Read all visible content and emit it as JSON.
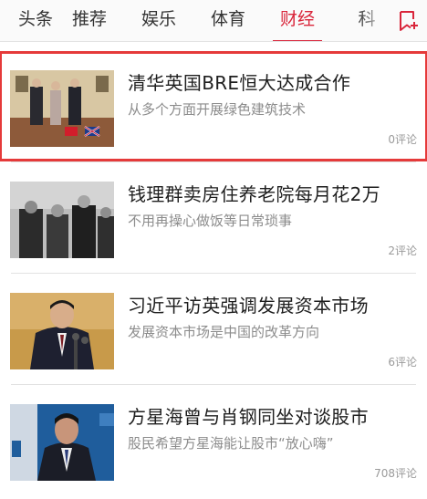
{
  "tabbar": {
    "tabs": [
      {
        "label": "头条",
        "active": false
      },
      {
        "label": "推荐",
        "active": false
      },
      {
        "label": "娱乐",
        "active": false
      },
      {
        "label": "体育",
        "active": false
      },
      {
        "label": "财经",
        "active": true
      },
      {
        "label": "科",
        "active": false
      }
    ],
    "add_icon": "add-channel-icon",
    "accent_color": "#d9263b"
  },
  "feed": {
    "items": [
      {
        "title": "清华英国BRE恒大达成合作",
        "subtitle": "从多个方面开展绿色建筑技术",
        "comments": "0评论",
        "selected": true,
        "image": "photo-signing-ceremony"
      },
      {
        "title": "钱理群卖房住养老院每月花2万",
        "subtitle": "不用再操心做饭等日常琐事",
        "comments": "2评论",
        "selected": false,
        "image": "photo-black-white-group"
      },
      {
        "title": "习近平访英强调发展资本市场",
        "subtitle": "发展资本市场是中国的改革方向",
        "comments": "6评论",
        "selected": false,
        "image": "photo-speaker-podium"
      },
      {
        "title": "方星海曾与肖钢同坐对谈股市",
        "subtitle": "股民希望方星海能让股市“放心嗨”",
        "comments": "708评论",
        "selected": false,
        "image": "photo-speaker-forum"
      }
    ]
  }
}
